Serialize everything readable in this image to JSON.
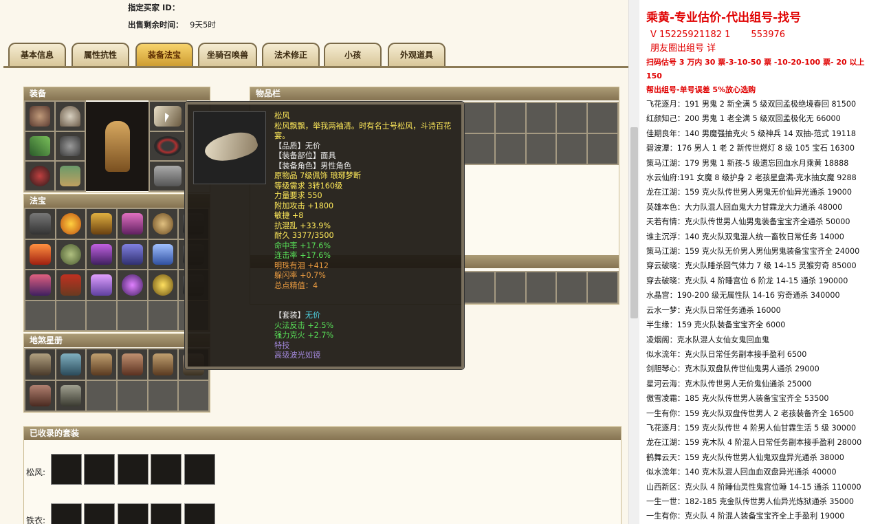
{
  "left": {
    "buyer_label": "指定买家 ID：",
    "time_label": "出售剩余时间：",
    "time_value": "9天5时",
    "tabs": [
      "基本信息",
      "属性抗性",
      "装备法宝",
      "坐骑召唤兽",
      "法术修正",
      "小孩",
      "外观道具"
    ],
    "active_tab": "装备法宝",
    "equip_title": "装备",
    "fabao_title": "法宝",
    "star_title": "地煞星册",
    "bag_title": "物品栏",
    "set_title": "已收录的套装",
    "set_rows": [
      {
        "label": "松风:"
      },
      {
        "label": "铁衣:"
      }
    ]
  },
  "tooltip": {
    "name": "松风",
    "desc": "松风飘飘，举我两袖清。时有名士号松风，斗诗百花宴。",
    "lines": [
      {
        "text": "【品质】无价",
        "color": "w"
      },
      {
        "text": "【装备部位】面具",
        "color": "w"
      },
      {
        "text": "【装备角色】男性角色",
        "color": "w"
      },
      {
        "text": "原物品 7级佩饰 琅琊梦断",
        "color": "y"
      },
      {
        "text": "等级需求 3转160级",
        "color": "y"
      },
      {
        "text": "力量要求 550",
        "color": "y"
      },
      {
        "text": "附加攻击 +1800",
        "color": "y"
      },
      {
        "text": "敏捷 +8",
        "color": "y"
      },
      {
        "text": "抗混乱 +33.9%",
        "color": "y"
      },
      {
        "text": "耐久 3377/3500",
        "color": "y"
      },
      {
        "text": "命中率 +17.6%",
        "color": "g"
      },
      {
        "text": "连击率 +17.6%",
        "color": "g"
      },
      {
        "text": "明珠有泪 +412",
        "color": "o"
      },
      {
        "text": "躲闪率 +0.7%",
        "color": "o"
      },
      {
        "text": "总点精值：4",
        "color": "o"
      }
    ],
    "set_label": "【套装】",
    "set_value": "无价",
    "set_lines": [
      {
        "text": "火法反击 +2.5%",
        "color": "g"
      },
      {
        "text": "强力克火 +2.7%",
        "color": "g"
      },
      {
        "text": "特技",
        "color": "v"
      },
      {
        "text": "高级波光如镜",
        "color": "v"
      }
    ]
  },
  "right": {
    "title": "乘黄-专业估价-代出组号-找号",
    "phone": "V 15225921182   1",
    "phone_tail": "553976",
    "friends": "朋友圈出组号  详",
    "promo1": "扫码估号 3 万内 30 票-3-10-50 票 -10-20-100 票- 20 以上 150",
    "promo2": "帮出组号-单号误差 5%放心选购",
    "listings": [
      "飞花逐月：191 男鬼 2 新全满 5 级双回孟极绝境春回 81500",
      "红颜知己：200 男鬼 1 老全满 5 级双回孟极化无 66000",
      "佳期良年：140 男魔强抽克火 5 级神兵 14 双抽-范式 19118",
      "碧波潭：176 男人 1 老 2 新传世燃灯 8 级 105 宝石 16300",
      "策马江湖：179 男鬼 1 新孩-5 级遗忘回血水月乘黄 18888",
      "水云仙府:191 女魔 8 级护身 2 老孩星盘满-克水抽女魔 9288",
      "龙在江湖：159 克火队传世男人男鬼无价仙异光通杀 19000",
      "英雄本色：大力队混人回血鬼大力甘霖龙大力通杀 48000",
      "天若有情：克火队传世男人仙男鬼装备宝宝齐全通杀 50000",
      "谁主沉浮：140 克火队双鬼混人统一畜牧日常任务 14000",
      "策马江湖：159 克火队无价男人男仙男鬼装备宝宝齐全 24000",
      "穿云破晓：克火队睡杀回气体力 7 级 14-15 灵猴穷奇 85000",
      "穿去破晓：克火队 4 阶睡宫位 6 阶龙 14-15 通杀 190000",
      "水晶宫：190-200 级无属性队 14-16 穷奇通杀 340000",
      "云水一梦：克火队日常任务通杀 16000",
      "半生缘：159 克火队装备宝宝齐全 6000",
      "凌烟阁：克水队混人女仙女鬼回血鬼",
      "似水流年：克火队日常任务副本接手盈利 6500",
      "剑胆琴心：克木队双盘队传世仙鬼男人通杀 29000",
      "星河云海：克木队传世男人无价鬼仙通杀 25000",
      "傲雪凌霜：185 克火队传世男人装备宝宝齐全 53500",
      "一生有你：159 克火队双盘传世男人 2 老孩装备齐全 16500",
      "飞花逐月：159 克火队传世 4 阶男人仙甘霖生活 5 级 30000",
      "龙在江湖：159 克木队 4 阶混人日常任务副本接手盈利 28000",
      "鹤舞云天：159 克火队传世男人仙鬼双盘异光通杀 38000",
      "似水流年：140 克木队混人回血血双盘异光通杀 40000",
      "山西新区：克火队 4 阶睡仙灵性鬼宫位睡 14-15 通杀 110000",
      "一生一世：182-185 克金队传世男人仙异光炼狱通杀 35000",
      "一生有你：克火队 4 阶混人装备宝宝齐全上手盈利 19000"
    ]
  }
}
